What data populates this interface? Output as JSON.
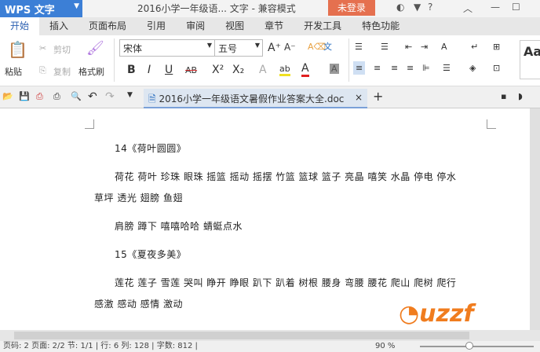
{
  "app": {
    "menu_label": "WPS 文字",
    "title": "2016小学一年级语... 文字 - 兼容模式",
    "login": "未登录"
  },
  "tabs": [
    "开始",
    "插入",
    "页面布局",
    "引用",
    "审阅",
    "视图",
    "章节",
    "开发工具",
    "特色功能"
  ],
  "ribbon": {
    "paste": "粘贴",
    "cut": "剪切",
    "copy": "复制",
    "format_painter": "格式刷",
    "font": "宋体",
    "size": "五号",
    "bold": "B",
    "italic": "I",
    "underline": "U",
    "strike": "AB",
    "superscript": "X²",
    "subscript": "X₂",
    "style_preview": "Aa"
  },
  "doc_tab": {
    "name": "2016小学一年级语文暑假作业答案大全.doc",
    "close": "×",
    "new": "+"
  },
  "document": {
    "paragraphs": [
      "14《荷叶圆圆》",
      "荷花 荷叶 珍珠 眼珠 摇篮 摇动 摇摆 竹篮 篮球 篮子 亮晶 嘻笑 水晶 停电 停水",
      "草坪 透光 翅膀 鱼翅",
      "肩膀 蹲下 嘻嘻哈哈 蜻蜓点水",
      "15《夏夜多美》",
      "莲花 莲子 雪莲 哭叫 睁开 睁眼 趴下 趴着 树根 腰身 弯腰 腰花 爬山 爬树 爬行",
      "感激 感动 感情 激动"
    ]
  },
  "status": {
    "text": "页码: 2  页面: 2/2  节: 1/1 | 行: 6  列: 128 | 字数: 812 |",
    "zoom": "90 %"
  },
  "watermark": "uzzf.com"
}
